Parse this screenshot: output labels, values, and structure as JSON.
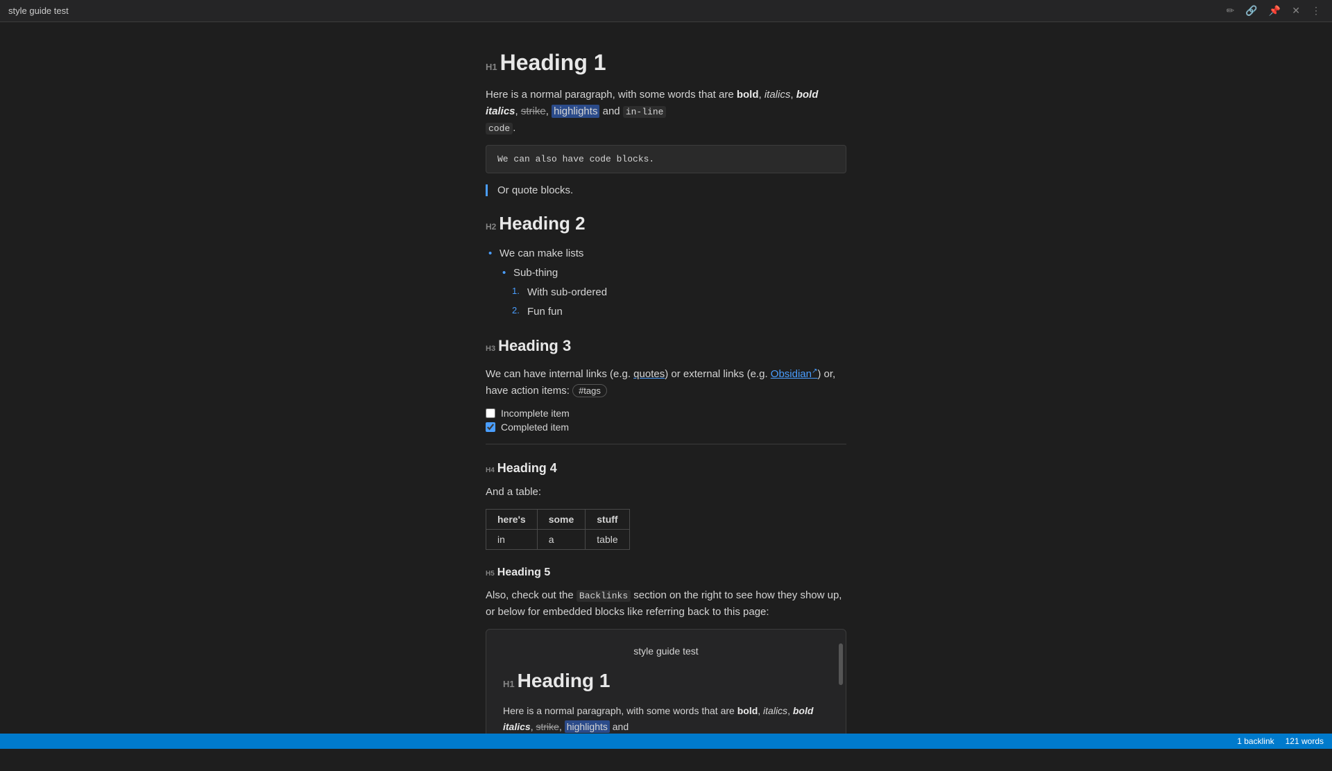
{
  "titlebar": {
    "title": "style guide test",
    "icons": {
      "edit": "✏",
      "link": "🔗",
      "pin": "📌",
      "close": "✕",
      "menu": "⋮"
    }
  },
  "document": {
    "h1": "Heading 1",
    "intro_paragraph": {
      "prefix": "Here is a normal paragraph, with some words that are ",
      "bold": "bold",
      "italic": "italics",
      "bold_italic": "bold italics",
      "strike": "strike",
      "highlight": "highlights",
      "and": "and",
      "inline_code": "in-line",
      "code2": "code",
      "suffix": "."
    },
    "code_block": "We can also have code blocks.",
    "blockquote": "Or quote blocks.",
    "h2": "Heading 2",
    "list_items": [
      "We can make lists",
      "Sub-thing"
    ],
    "ordered_items": [
      "With sub-ordered",
      "Fun fun"
    ],
    "h3": "Heading 3",
    "links_paragraph": {
      "prefix": "We can have internal links (e.g. ",
      "internal_link": "quotes",
      "middle": ") or external links (e.g. ",
      "external_link": "Obsidian",
      "ext_icon": "↗",
      "middle2": ") or, have action items:",
      "tag": "#tags"
    },
    "incomplete_item": "Incomplete item",
    "completed_item": "Completed item",
    "h4": "Heading 4",
    "table_intro": "And a table:",
    "table": {
      "headers": [
        "here's",
        "some",
        "stuff"
      ],
      "rows": [
        [
          "in",
          "a",
          "table"
        ]
      ]
    },
    "h5": "Heading 5",
    "h5_paragraph": {
      "prefix": "Also, check out the ",
      "code": "Backlinks",
      "suffix": " section on the right to see how they show up, or below for embedded blocks like referring back to this page:"
    },
    "embedded": {
      "title": "style guide test",
      "h1": "Heading 1",
      "paragraph": {
        "prefix": "Here is a normal paragraph, with some words that are ",
        "bold": "bold",
        "italic": "italics",
        "bold_italic": "bold italics",
        "strike": "strike",
        "highlight": "highlights",
        "and": "and"
      }
    }
  },
  "statusbar": {
    "backlinks": "1 backlink",
    "words": "121 words"
  }
}
